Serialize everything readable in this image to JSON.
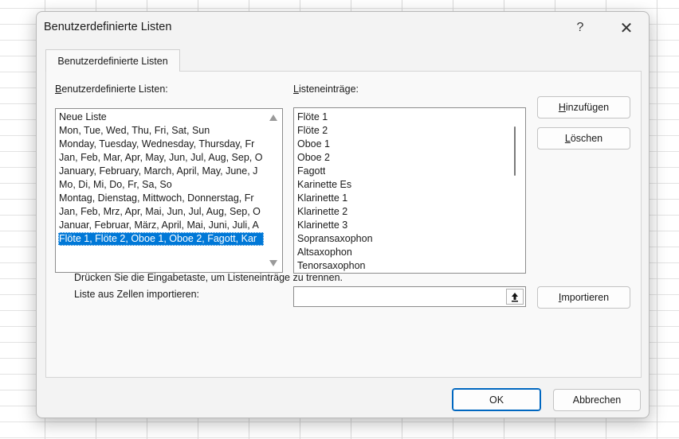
{
  "dialog": {
    "title": "Benutzerdefinierte Listen",
    "help_label": "?",
    "close_label": "✕"
  },
  "tab": {
    "label": "Benutzerdefinierte Listen"
  },
  "lists": {
    "label_accesskey": "B",
    "label_rest": "enutzerdefinierte Listen:",
    "items": [
      "Neue Liste",
      "Mon, Tue, Wed, Thu, Fri, Sat, Sun",
      "Monday, Tuesday, Wednesday, Thursday, Fr",
      "Jan, Feb, Mar, Apr, May, Jun, Jul, Aug, Sep, O",
      "January, February, March, April, May, June, J",
      "Mo, Di, Mi, Do, Fr, Sa, So",
      "Montag, Dienstag, Mittwoch, Donnerstag, Fr",
      "Jan, Feb, Mrz, Apr, Mai, Jun, Jul, Aug, Sep, O",
      "Januar, Februar, März, April, Mai, Juni, Juli, A",
      "Flöte 1, Flöte 2, Oboe 1, Oboe 2, Fagott, Kar"
    ],
    "selected_index": 9
  },
  "entries": {
    "label_accesskey": "L",
    "label_rest": "isteneinträge:",
    "items": [
      "Flöte 1",
      "Flöte 2",
      "Oboe 1",
      "Oboe 2",
      "Fagott",
      "Karinette Es",
      "Klarinette 1",
      "Klarinette 2",
      "Klarinette 3",
      "Sopransaxophon",
      "Altsaxophon",
      "Tenorsaxophon"
    ]
  },
  "buttons": {
    "add_accesskey": "H",
    "add_rest": "inzufügen",
    "delete_accesskey": "L",
    "delete_rest": "öschen",
    "import_accesskey": "I",
    "import_rest": "mportieren",
    "ok": "OK",
    "cancel": "Abbrechen"
  },
  "hints": {
    "separator_hint": "Drücken Sie die Eingabetaste, um Listeneinträge zu trennen.",
    "import_label": "Liste aus Zellen importieren:"
  },
  "import_field": {
    "value": ""
  },
  "icons": {
    "range_select": "range-select-icon",
    "help": "help-icon",
    "close": "close-icon"
  }
}
